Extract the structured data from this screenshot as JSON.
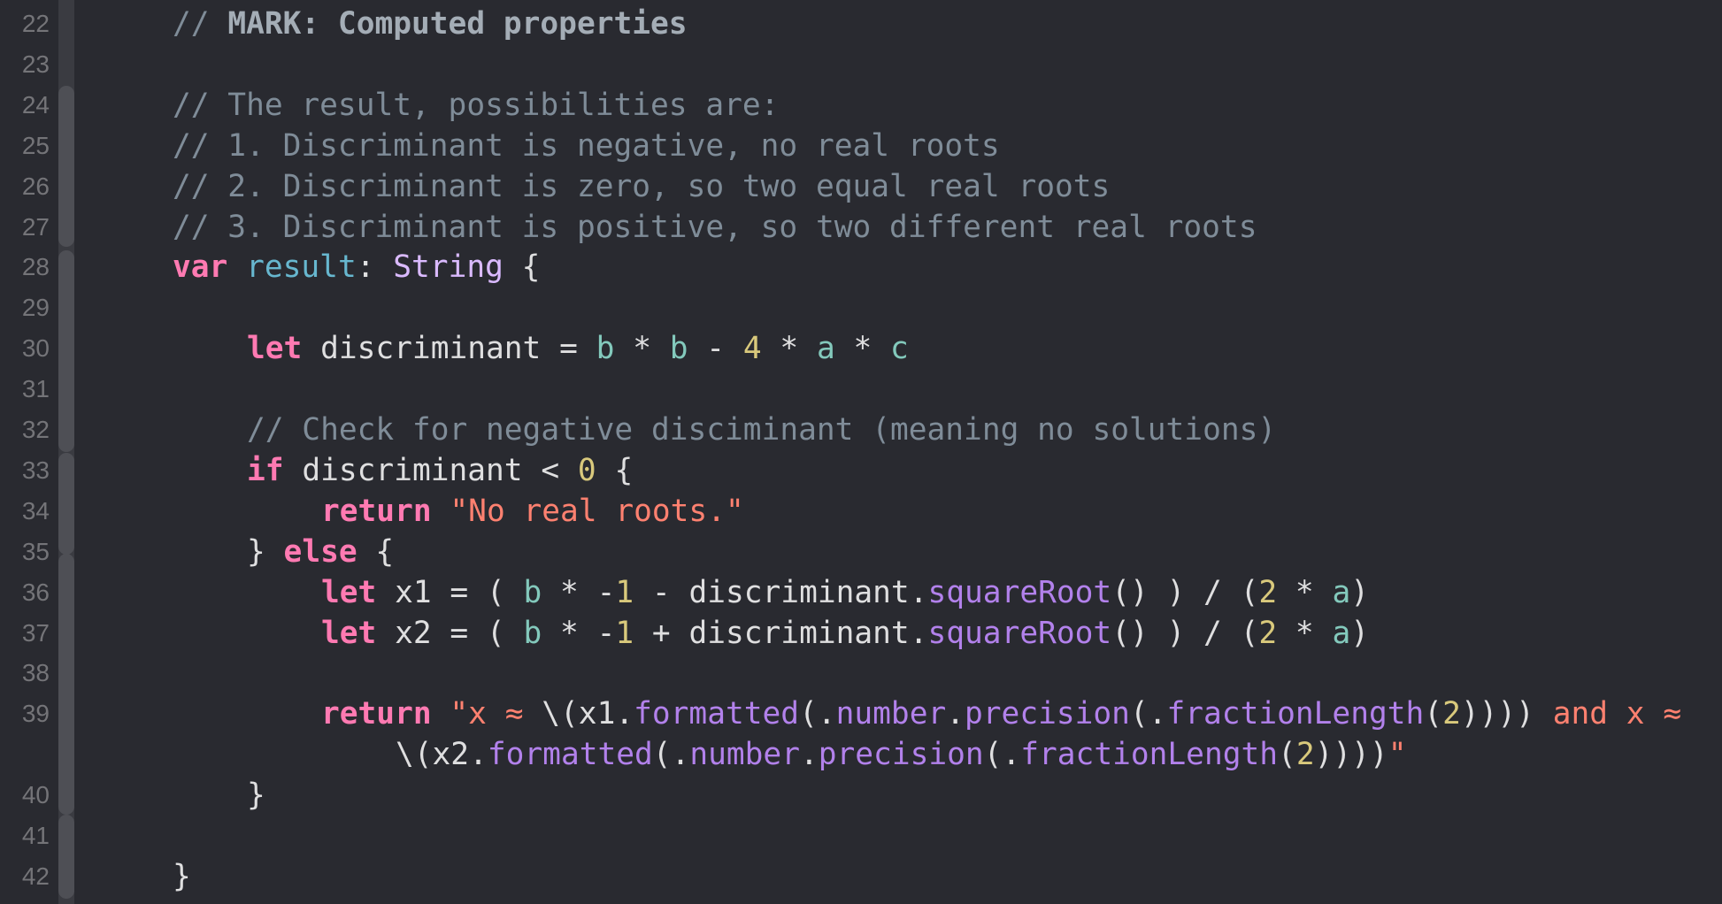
{
  "editor": {
    "theme_colors": {
      "background": "#292a30",
      "line_number": "#747478",
      "comment": "#7f8c98",
      "keyword": "#ff7ab2",
      "declaration": "#67b7cf",
      "type": "#dabaff",
      "plain": "#dfdfe0",
      "variable": "#83c9bc",
      "number": "#d9c97c",
      "string": "#ff8170",
      "method": "#b281eb"
    },
    "lines": [
      {
        "number": "22",
        "indent": 1,
        "tokens": [
          {
            "t": "comment",
            "v": "// "
          },
          {
            "t": "mark",
            "v": "MARK: Computed properties"
          }
        ]
      },
      {
        "number": "23",
        "indent": 0,
        "tokens": []
      },
      {
        "number": "24",
        "indent": 1,
        "tokens": [
          {
            "t": "comment",
            "v": "// The result, possibilities are:"
          }
        ]
      },
      {
        "number": "25",
        "indent": 1,
        "tokens": [
          {
            "t": "comment",
            "v": "// 1. Discriminant is negative, no real roots"
          }
        ]
      },
      {
        "number": "26",
        "indent": 1,
        "tokens": [
          {
            "t": "comment",
            "v": "// 2. Discriminant is zero, so two equal real roots"
          }
        ]
      },
      {
        "number": "27",
        "indent": 1,
        "tokens": [
          {
            "t": "comment",
            "v": "// 3. Discriminant is positive, so two different real roots"
          }
        ]
      },
      {
        "number": "28",
        "indent": 1,
        "tokens": [
          {
            "t": "kw",
            "v": "var"
          },
          {
            "t": "plain",
            "v": " "
          },
          {
            "t": "decl",
            "v": "result"
          },
          {
            "t": "plain",
            "v": ": "
          },
          {
            "t": "type",
            "v": "String"
          },
          {
            "t": "plain",
            "v": " {"
          }
        ]
      },
      {
        "number": "29",
        "indent": 0,
        "tokens": []
      },
      {
        "number": "30",
        "indent": 2,
        "tokens": [
          {
            "t": "kw",
            "v": "let"
          },
          {
            "t": "plain",
            "v": " discriminant = "
          },
          {
            "t": "var",
            "v": "b"
          },
          {
            "t": "plain",
            "v": " * "
          },
          {
            "t": "var",
            "v": "b"
          },
          {
            "t": "plain",
            "v": " - "
          },
          {
            "t": "num",
            "v": "4"
          },
          {
            "t": "plain",
            "v": " * "
          },
          {
            "t": "var",
            "v": "a"
          },
          {
            "t": "plain",
            "v": " * "
          },
          {
            "t": "var",
            "v": "c"
          }
        ]
      },
      {
        "number": "31",
        "indent": 0,
        "tokens": []
      },
      {
        "number": "32",
        "indent": 2,
        "tokens": [
          {
            "t": "comment",
            "v": "// Check for negative disciminant (meaning no solutions)"
          }
        ]
      },
      {
        "number": "33",
        "indent": 2,
        "tokens": [
          {
            "t": "kw",
            "v": "if"
          },
          {
            "t": "plain",
            "v": " discriminant < "
          },
          {
            "t": "num",
            "v": "0"
          },
          {
            "t": "plain",
            "v": " {"
          }
        ]
      },
      {
        "number": "34",
        "indent": 3,
        "tokens": [
          {
            "t": "kw",
            "v": "return"
          },
          {
            "t": "plain",
            "v": " "
          },
          {
            "t": "str",
            "v": "\"No real roots.\""
          }
        ]
      },
      {
        "number": "35",
        "indent": 2,
        "tokens": [
          {
            "t": "plain",
            "v": "} "
          },
          {
            "t": "kw",
            "v": "else"
          },
          {
            "t": "plain",
            "v": " {"
          }
        ]
      },
      {
        "number": "36",
        "indent": 3,
        "tokens": [
          {
            "t": "kw",
            "v": "let"
          },
          {
            "t": "plain",
            "v": " x1 = ( "
          },
          {
            "t": "var",
            "v": "b"
          },
          {
            "t": "plain",
            "v": " * -"
          },
          {
            "t": "num",
            "v": "1"
          },
          {
            "t": "plain",
            "v": " - discriminant."
          },
          {
            "t": "method",
            "v": "squareRoot"
          },
          {
            "t": "plain",
            "v": "() ) / ("
          },
          {
            "t": "num",
            "v": "2"
          },
          {
            "t": "plain",
            "v": " * "
          },
          {
            "t": "var",
            "v": "a"
          },
          {
            "t": "plain",
            "v": ")"
          }
        ]
      },
      {
        "number": "37",
        "indent": 3,
        "tokens": [
          {
            "t": "kw",
            "v": "let"
          },
          {
            "t": "plain",
            "v": " x2 = ( "
          },
          {
            "t": "var",
            "v": "b"
          },
          {
            "t": "plain",
            "v": " * -"
          },
          {
            "t": "num",
            "v": "1"
          },
          {
            "t": "plain",
            "v": " + discriminant."
          },
          {
            "t": "method",
            "v": "squareRoot"
          },
          {
            "t": "plain",
            "v": "() ) / ("
          },
          {
            "t": "num",
            "v": "2"
          },
          {
            "t": "plain",
            "v": " * "
          },
          {
            "t": "var",
            "v": "a"
          },
          {
            "t": "plain",
            "v": ")"
          }
        ]
      },
      {
        "number": "38",
        "indent": 0,
        "tokens": []
      },
      {
        "number": "39",
        "indent": 3,
        "tokens": [
          {
            "t": "kw",
            "v": "return"
          },
          {
            "t": "plain",
            "v": " "
          },
          {
            "t": "str",
            "v": "\"x ≈ "
          },
          {
            "t": "plain",
            "v": "\\(x1."
          },
          {
            "t": "method",
            "v": "formatted"
          },
          {
            "t": "plain",
            "v": "(."
          },
          {
            "t": "method",
            "v": "number"
          },
          {
            "t": "plain",
            "v": "."
          },
          {
            "t": "method",
            "v": "precision"
          },
          {
            "t": "plain",
            "v": "(."
          },
          {
            "t": "method",
            "v": "fractionLength"
          },
          {
            "t": "plain",
            "v": "("
          },
          {
            "t": "num",
            "v": "2"
          },
          {
            "t": "plain",
            "v": "))))"
          },
          {
            "t": "str",
            "v": " and x ≈"
          }
        ]
      },
      {
        "number": "",
        "indent": 4,
        "tokens": [
          {
            "t": "plain",
            "v": "\\(x2."
          },
          {
            "t": "method",
            "v": "formatted"
          },
          {
            "t": "plain",
            "v": "(."
          },
          {
            "t": "method",
            "v": "number"
          },
          {
            "t": "plain",
            "v": "."
          },
          {
            "t": "method",
            "v": "precision"
          },
          {
            "t": "plain",
            "v": "(."
          },
          {
            "t": "method",
            "v": "fractionLength"
          },
          {
            "t": "plain",
            "v": "("
          },
          {
            "t": "num",
            "v": "2"
          },
          {
            "t": "plain",
            "v": "))))"
          },
          {
            "t": "str",
            "v": "\""
          }
        ]
      },
      {
        "number": "40",
        "indent": 2,
        "tokens": [
          {
            "t": "plain",
            "v": "}"
          }
        ]
      },
      {
        "number": "41",
        "indent": 0,
        "tokens": []
      },
      {
        "number": "42",
        "indent": 1,
        "tokens": [
          {
            "t": "plain",
            "v": "}"
          }
        ]
      }
    ]
  }
}
